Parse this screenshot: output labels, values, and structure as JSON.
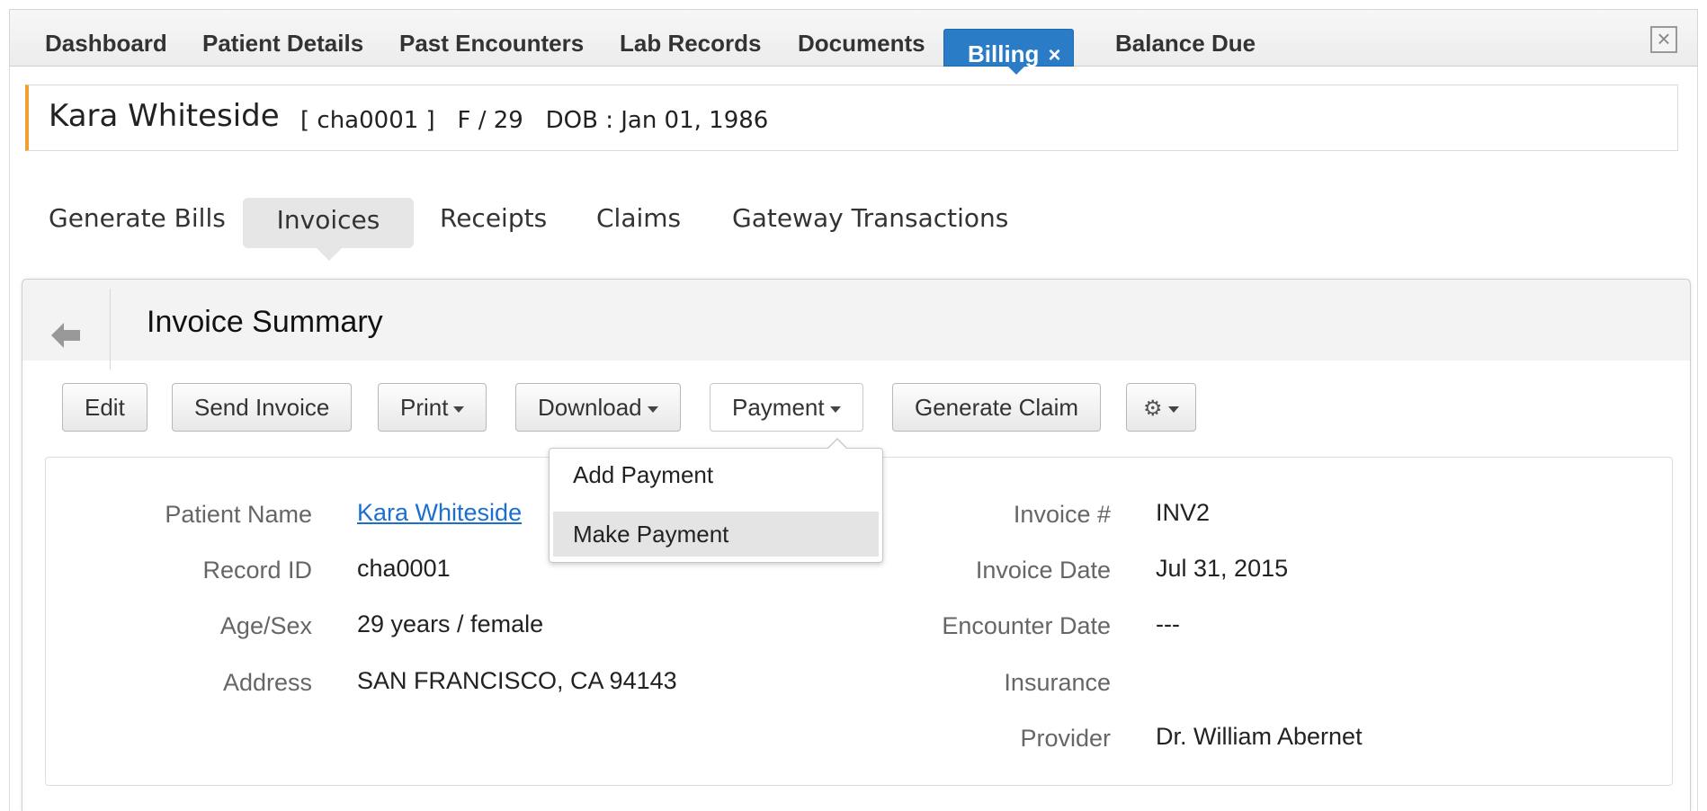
{
  "top_tabs": {
    "dashboard": "Dashboard",
    "patient_details": "Patient Details",
    "past_encounters": "Past Encounters",
    "lab_records": "Lab Records",
    "documents": "Documents",
    "billing": "Billing",
    "billing_close": "×",
    "balance_due": "Balance Due",
    "window_close": "×"
  },
  "patient": {
    "name": "Kara Whiteside",
    "meta": "[ cha0001 ]   F / 29   DOB : Jan 01, 1986"
  },
  "sub_tabs": {
    "generate_bills": "Generate Bills",
    "invoices": "Invoices",
    "receipts": "Receipts",
    "claims": "Claims",
    "gateway_transactions": "Gateway Transactions"
  },
  "panel": {
    "title": "Invoice Summary"
  },
  "toolbar": {
    "edit": "Edit",
    "send_invoice": "Send Invoice",
    "print": "Print",
    "download": "Download",
    "payment": "Payment",
    "generate_claim": "Generate Claim",
    "gear_glyph": "⚙"
  },
  "payment_menu": {
    "add_payment": "Add Payment",
    "make_payment": "Make Payment"
  },
  "details": {
    "left": [
      {
        "label": "Patient Name",
        "value": "Kara Whiteside"
      },
      {
        "label": "Record ID",
        "value": "cha0001"
      },
      {
        "label": "Age/Sex",
        "value": "29 years / female"
      },
      {
        "label": "Address",
        "value": "SAN FRANCISCO, CA 94143"
      }
    ],
    "right": [
      {
        "label": "Invoice #",
        "value": "INV2"
      },
      {
        "label": "Invoice Date",
        "value": "Jul 31, 2015"
      },
      {
        "label": "Encounter Date",
        "value": "---"
      },
      {
        "label": "Insurance",
        "value": ""
      },
      {
        "label": "Provider",
        "value": "Dr. William Abernet"
      }
    ]
  },
  "colors": {
    "accent": "#2a7cc7",
    "link": "#1b6fd1",
    "header_stripe": "#f0a030"
  }
}
